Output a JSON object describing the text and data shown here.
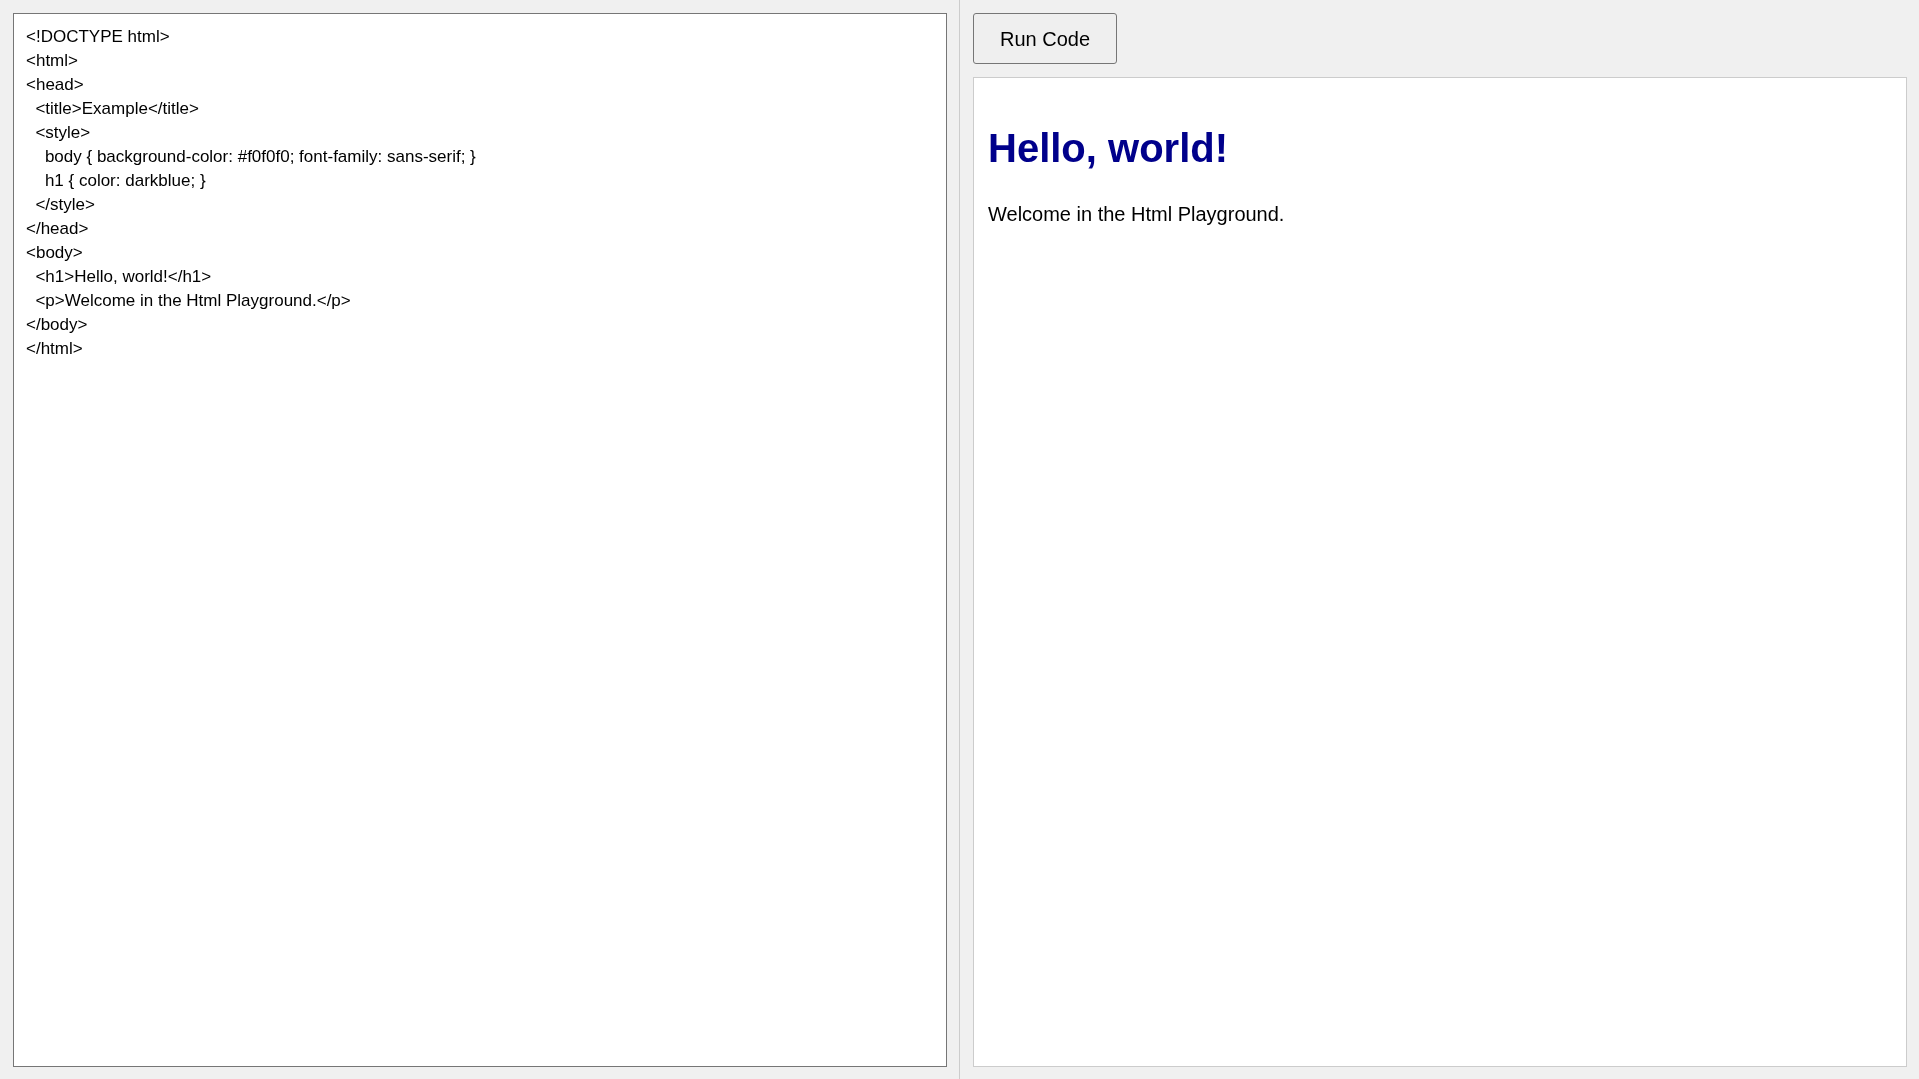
{
  "editor": {
    "code_lines": [
      "<!DOCTYPE html>",
      "<html>",
      "<head>",
      "  <title>Example</title>",
      "  <style>",
      "    body { background-color: #f0f0f0; font-family: sans-serif; }",
      "    h1 { color: darkblue; }",
      "  </style>",
      "</head>",
      "<body>",
      "  <h1>Hello, world!</h1>",
      "  <p>Welcome in the Html Playground.</p>",
      "</body>",
      "</html>"
    ]
  },
  "run_button": {
    "label": "Run Code"
  },
  "preview": {
    "heading": "Hello, world!",
    "paragraph": "Welcome in the Html Playground."
  }
}
